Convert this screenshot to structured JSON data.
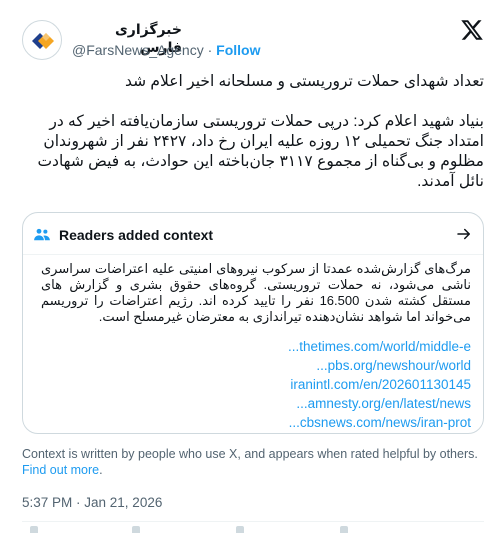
{
  "tweet": {
    "author": {
      "name": "خبرگزاری فارس",
      "handle": "@FarsNews_Agency",
      "separator": "·",
      "follow_label": "Follow",
      "avatar_icon": "fars-news-logo",
      "brand_colors": [
        "#f5a623",
        "#1f3f8c"
      ]
    },
    "platform_icon": "x-logo",
    "headline": "تعداد شهدای حملات تروریستی و مسلحانه اخیر اعلام شد",
    "body": "بنیاد شهید اعلام کرد: درپی حملات تروریستی سازمان‌یافته اخیر که در امتداد جنگ تحمیلی ۱۲ روزه علیه ایران رخ داد، ۲۴۲۷ نفر از شهروندان مظلوم و بی‌گناه از مجموع ۳۱۱۷ جان‌باخته این حوادث، به فیض شهادت نائل آمدند.",
    "timestamp": "5:37 PM · Jan 21, 2026"
  },
  "context": {
    "title": "Readers added context",
    "header_icon": "people-icon",
    "arrow_icon": "arrow-right-icon",
    "body": "مرگ‌های گزارش‌شده عمدتا از سرکوب نیروهای امنیتی علیه اعتراضات سراسری ناشی می‌شود، نه حملات تروریستی. گروه‌های حقوق بشری و گزارش های مستقل کشته شدن 16.500 نفر را تایید کرده اند. رژیم اعتراضات را تروریسم می‌خواند اما شواهد نشان‌دهنده تیراندازی به معترضان غیرمسلح است.",
    "links": [
      "...thetimes.com/world/middle-e",
      "...pbs.org/newshour/world",
      "iranintl.com/en/202601130145",
      "...amnesty.org/en/latest/news",
      "...cbsnews.com/news/iran-prot"
    ]
  },
  "disclaimer": {
    "text": "Context is written by people who use X, and appears when rated helpful by others. ",
    "link_text": "Find out more",
    "suffix": "."
  },
  "colors": {
    "accent": "#1d9bf0",
    "muted": "#536471",
    "border": "#cfd9de",
    "text": "#0f1419"
  }
}
